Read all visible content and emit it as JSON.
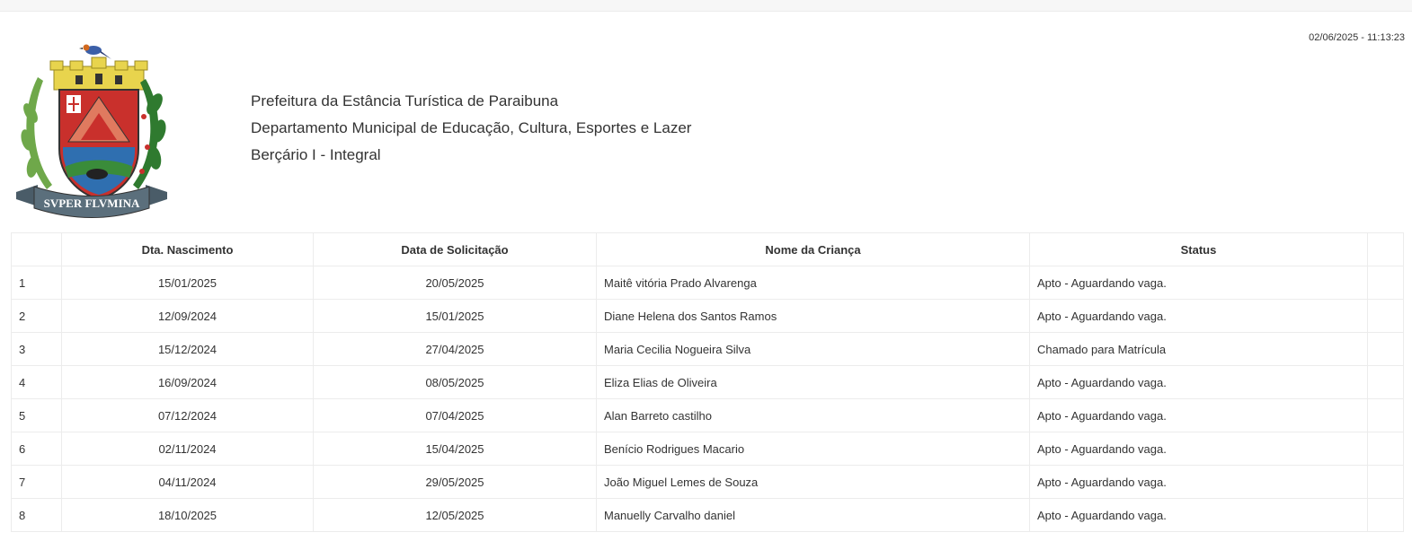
{
  "timestamp": "02/06/2025 - 11:13:23",
  "crest": {
    "motto": "SVPER FLVMINA",
    "icon": "municipal-coat-of-arms",
    "colors": {
      "crown": "#e8d44d",
      "shield_red": "#c9302c",
      "banner": "#5b6f7c",
      "laurel": "#3a8c3a"
    }
  },
  "header": {
    "line1": "Prefeitura da Estância Turística de Paraibuna",
    "line2": "Departamento Municipal de Educação, Cultura, Esportes e Lazer",
    "line3": "Berçário I - Integral"
  },
  "table": {
    "columns": [
      "",
      "Dta. Nascimento",
      "Data de Solicitação",
      "Nome da Criança",
      "Status",
      ""
    ],
    "rows": [
      {
        "n": "1",
        "nascimento": "15/01/2025",
        "solicitacao": "20/05/2025",
        "nome": "Maitê vitória Prado Alvarenga",
        "status": "Apto - Aguardando vaga."
      },
      {
        "n": "2",
        "nascimento": "12/09/2024",
        "solicitacao": "15/01/2025",
        "nome": "Diane Helena dos Santos Ramos",
        "status": "Apto - Aguardando vaga."
      },
      {
        "n": "3",
        "nascimento": "15/12/2024",
        "solicitacao": "27/04/2025",
        "nome": "Maria Cecilia Nogueira Silva",
        "status": "Chamado para Matrícula"
      },
      {
        "n": "4",
        "nascimento": "16/09/2024",
        "solicitacao": "08/05/2025",
        "nome": "Eliza Elias de Oliveira",
        "status": "Apto - Aguardando vaga."
      },
      {
        "n": "5",
        "nascimento": "07/12/2024",
        "solicitacao": "07/04/2025",
        "nome": "Alan Barreto castilho",
        "status": "Apto - Aguardando vaga."
      },
      {
        "n": "6",
        "nascimento": "02/11/2024",
        "solicitacao": "15/04/2025",
        "nome": "Benício Rodrigues Macario",
        "status": "Apto - Aguardando vaga."
      },
      {
        "n": "7",
        "nascimento": "04/11/2024",
        "solicitacao": "29/05/2025",
        "nome": "João Miguel Lemes de Souza",
        "status": "Apto - Aguardando vaga."
      },
      {
        "n": "8",
        "nascimento": "18/10/2025",
        "solicitacao": "12/05/2025",
        "nome": "Manuelly Carvalho daniel",
        "status": "Apto - Aguardando vaga."
      }
    ]
  }
}
